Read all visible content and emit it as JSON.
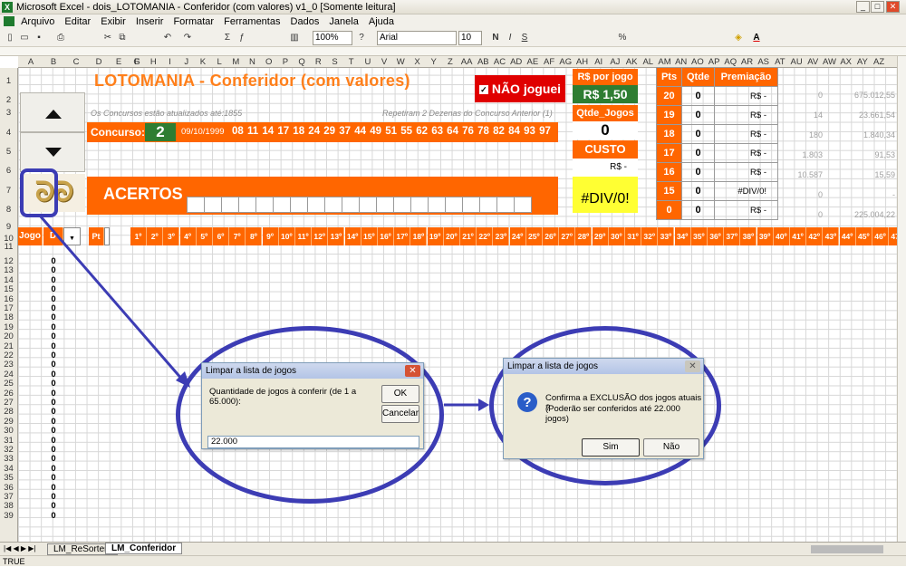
{
  "window": {
    "title": "Microsoft Excel - dois_LOTOMANIA - Conferidor (com valores) v1_0  [Somente leitura]"
  },
  "menu": [
    "Arquivo",
    "Editar",
    "Exibir",
    "Inserir",
    "Formatar",
    "Ferramentas",
    "Dados",
    "Janela",
    "Ajuda"
  ],
  "toolbar": {
    "zoom": "100%",
    "font": "Arial",
    "size": "10"
  },
  "sheet": {
    "title": "LOTOMANIA - Conferidor (com valores)",
    "info_left": "Os Concursos estão atualizados até:1855",
    "info_right": "Repetiram 2 Dezenas do Concurso Anterior (1)",
    "concurso_label": "Concurso:",
    "concurso_num": "2",
    "concurso_date": "09/10/1999",
    "numbers": "08 11 14 17 18 24 29 37 44 49 51 55 62 63 64 76 78 82 84 93 97",
    "acertos_label": "ACERTOS",
    "nao_joguei": "NÃO joguei",
    "rs_por_jogo_label": "R$ por jogo",
    "rs_por_jogo": "R$ 1,50",
    "qtde_jogos_label": "Qtde_Jogos",
    "qtde_jogos": "0",
    "custo_label": "CUSTO",
    "custo": "R$ -",
    "div_error": "#DIV/0!",
    "pts_headers": [
      "Pts",
      "Qtde",
      "Premiação"
    ],
    "pts_rows": [
      {
        "pts": "20",
        "qtde": "0",
        "prem": "R$ -",
        "e1": "0",
        "e2": "675.012,55"
      },
      {
        "pts": "19",
        "qtde": "0",
        "prem": "R$ -",
        "e1": "14",
        "e2": "23.661,54"
      },
      {
        "pts": "18",
        "qtde": "0",
        "prem": "R$ -",
        "e1": "180",
        "e2": "1.840,34"
      },
      {
        "pts": "17",
        "qtde": "0",
        "prem": "R$ -",
        "e1": "1.803",
        "e2": "91,53"
      },
      {
        "pts": "16",
        "qtde": "0",
        "prem": "R$ -",
        "e1": "10.587",
        "e2": "15,59"
      },
      {
        "pts": "15",
        "qtde": "0",
        "prem": "#DIV/0!",
        "e1": "0",
        "e2": "-"
      },
      {
        "pts": "0",
        "qtde": "0",
        "prem": "R$ -",
        "e1": "0",
        "e2": "225.004,22"
      }
    ],
    "row11": {
      "jogo": "Jogo",
      "d": "D",
      "pt": "Pt"
    },
    "tabs": [
      "LM_ReSorteio",
      "LM_Conferidor"
    ],
    "status": "TRUE"
  },
  "dialog1": {
    "title": "Limpar a lista de jogos",
    "prompt": "Quantidade de jogos à conferir (de 1 a 65.000):",
    "ok": "OK",
    "cancel": "Cancelar",
    "value": "22.000"
  },
  "dialog2": {
    "title": "Limpar a lista de jogos",
    "line1": "Confirma a EXCLUSÃO dos jogos atuais ?",
    "line2": "(Poderão ser conferidos até 22.000 jogos)",
    "yes": "Sim",
    "no": "Não"
  },
  "colors": {
    "orange": "#ff6600",
    "green": "#2e7d32",
    "annotation": "#3c3cb4"
  }
}
